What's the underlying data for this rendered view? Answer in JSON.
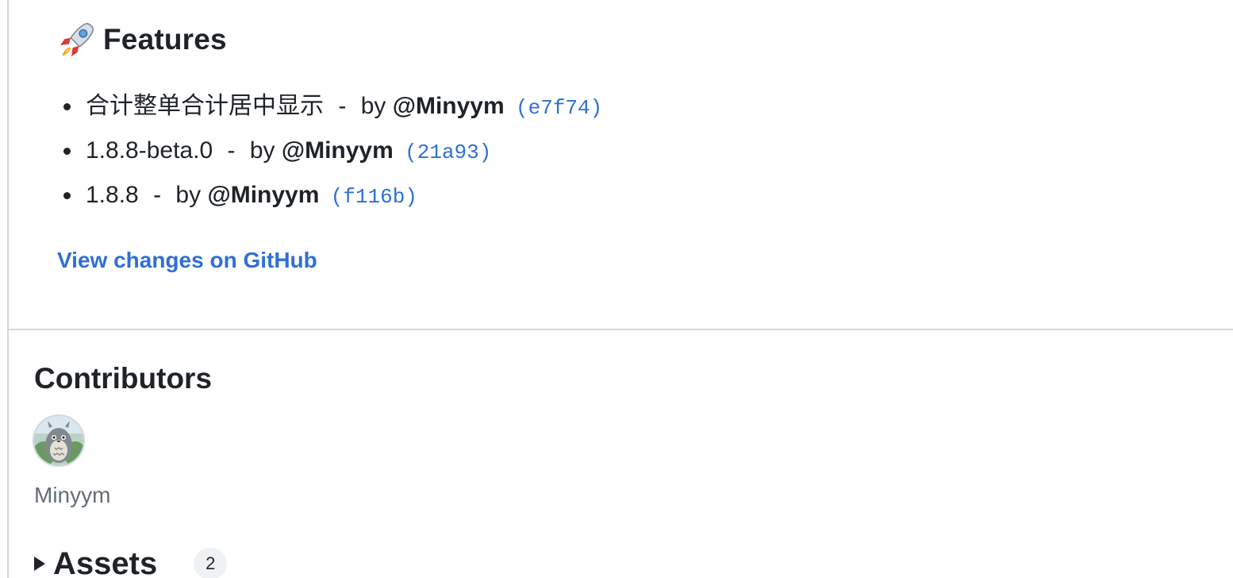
{
  "release_notes": {
    "features_heading": "Features",
    "features_icon": "rocket-icon",
    "features": [
      {
        "text": "合计整单合计居中显示",
        "separator": "-",
        "by": "by",
        "author": "@Minyym",
        "commit": "(e7f74)"
      },
      {
        "text": "1.8.8-beta.0",
        "separator": "-",
        "by": "by",
        "author": "@Minyym",
        "commit": "(21a93)"
      },
      {
        "text": "1.8.8",
        "separator": "-",
        "by": "by",
        "author": "@Minyym",
        "commit": "(f116b)"
      }
    ],
    "view_changes_label": "View changes on GitHub"
  },
  "contributors": {
    "title": "Contributors",
    "items": [
      {
        "name": "Minyym",
        "avatar_icon": "totoro-avatar"
      }
    ]
  },
  "assets": {
    "title": "Assets",
    "count": "2",
    "expanded": false
  },
  "colors": {
    "link": "#2f6fd6",
    "text": "#1f2328",
    "muted": "#656d76",
    "border": "#d0d7de"
  }
}
